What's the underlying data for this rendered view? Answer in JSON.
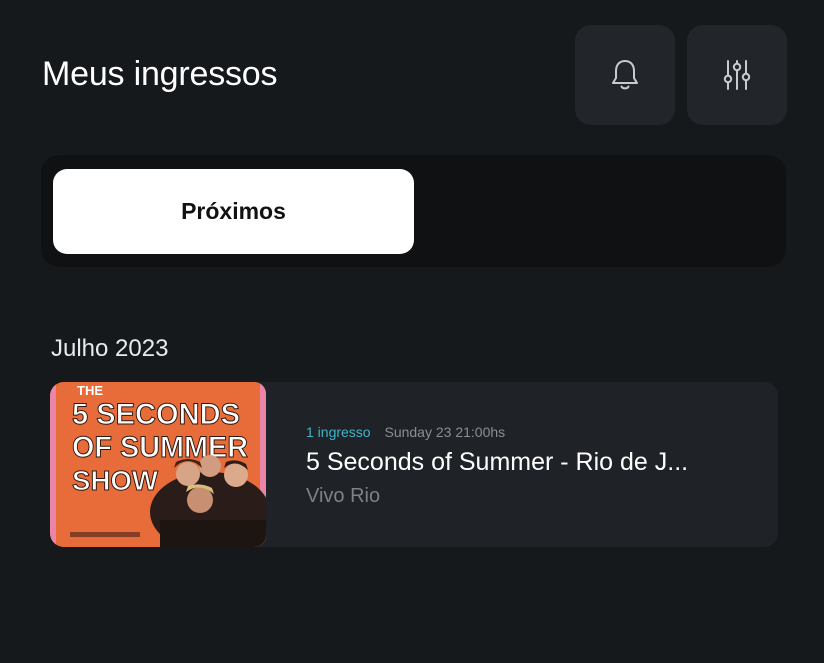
{
  "header": {
    "title": "Meus ingressos",
    "notifications_icon": "bell-icon",
    "filter_icon": "sliders-icon"
  },
  "tabs": {
    "active_label": "Próximos"
  },
  "sections": [
    {
      "month": "Julho 2023",
      "tickets": [
        {
          "count_label": "1 ingresso",
          "datetime": "Sunday 23 21:00hs",
          "title": "5 Seconds of Summer - Rio de J...",
          "venue": "Vivo Rio",
          "poster": {
            "line1": "THE",
            "line2": "5 SECONDS",
            "line3": "OF SUMMER",
            "line4": "SHOW"
          }
        }
      ]
    }
  ],
  "colors": {
    "background": "#16191c",
    "card": "#1f2226",
    "accent": "#3fb6c8",
    "poster_orange": "#e86c3a"
  }
}
